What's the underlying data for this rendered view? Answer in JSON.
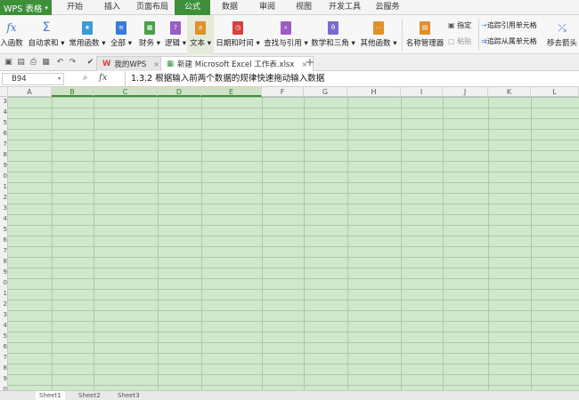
{
  "menubar": {
    "app_label": "WPS 表格",
    "tabs": [
      {
        "label": "开始",
        "active": false
      },
      {
        "label": "插入",
        "active": false
      },
      {
        "label": "页面布局",
        "active": false
      },
      {
        "label": "公式",
        "active": true
      },
      {
        "label": "数据",
        "active": false
      },
      {
        "label": "审阅",
        "active": false
      },
      {
        "label": "视图",
        "active": false
      },
      {
        "label": "开发工具",
        "active": false
      },
      {
        "label": "云服务",
        "active": false
      }
    ]
  },
  "ribbon": {
    "buttons": [
      {
        "label": "入函数",
        "icon": "fx-icon",
        "color": "#3a7bd5"
      },
      {
        "label": "自动求和",
        "icon": "sigma-icon",
        "color": "#3a7bd5"
      },
      {
        "label": "常用函数",
        "icon": "star-book-icon",
        "color": "#3a9bd5"
      },
      {
        "label": "全部",
        "icon": "book-icon",
        "color": "#3a7bd5"
      },
      {
        "label": "财务",
        "icon": "finance-icon",
        "color": "#4aa04a"
      },
      {
        "label": "逻辑",
        "icon": "logic-icon",
        "color": "#9a5cc6"
      },
      {
        "label": "文本",
        "icon": "text-icon",
        "color": "#e0902a"
      },
      {
        "label": "日期和时间",
        "icon": "clock-icon",
        "color": "#d84040"
      },
      {
        "label": "查找与引用",
        "icon": "lookup-icon",
        "color": "#9a5cc6"
      },
      {
        "label": "数学和三角",
        "icon": "math-icon",
        "color": "#7a6ad0"
      },
      {
        "label": "其他函数",
        "icon": "more-functions-icon",
        "color": "#e0902a"
      },
      {
        "label": "名称管理器",
        "icon": "name-manager-icon",
        "color": "#e0902a"
      }
    ],
    "small_items": [
      {
        "label": "指定",
        "enabled": true
      },
      {
        "label": "粘贴",
        "enabled": false
      },
      {
        "label": "追踪引用单元格",
        "enabled": true
      },
      {
        "label": "追踪从属单元格",
        "enabled": true
      },
      {
        "label": "移去箭头",
        "enabled": true
      }
    ],
    "dropdown_caret": "▾"
  },
  "quickbar": {
    "doc_tabs": [
      {
        "label": "我的WPS",
        "active": false,
        "close": "×"
      },
      {
        "label": "新建 Microsoft Excel 工作表.xlsx",
        "active": true,
        "close": "×"
      }
    ],
    "add_tab": "+"
  },
  "formula_bar": {
    "name_box": "B94",
    "fx": "fx",
    "value": "1.3.2 根据输入前两个数据的规律快速拖动输入数据"
  },
  "grid": {
    "columns": [
      "A",
      "B",
      "C",
      "D",
      "E",
      "F",
      "G",
      "H",
      "I",
      "J",
      "K",
      "L"
    ],
    "selected_columns": [
      "B",
      "C",
      "D",
      "E"
    ],
    "row_labels": [
      "3",
      "4",
      "5",
      "6",
      "7",
      "8",
      "9",
      "0",
      "1",
      "2",
      "3",
      "4",
      "5",
      "6",
      "7",
      "8",
      "9",
      "0",
      "1",
      "2",
      "3",
      "4",
      "5",
      "6",
      "7",
      "8",
      "9",
      "0"
    ],
    "cell_color": "#cfe8cc",
    "grid_color": "#a0be9e"
  },
  "sheets": {
    "tabs": [
      {
        "label": "Sheet1",
        "active": true
      },
      {
        "label": "Sheet2",
        "active": false
      },
      {
        "label": "Sheet3",
        "active": false
      }
    ]
  },
  "colors": {
    "accent": "#3d8f3a"
  }
}
